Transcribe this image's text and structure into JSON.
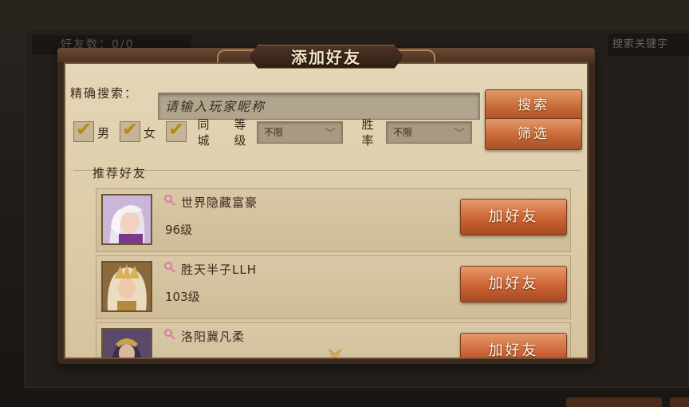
{
  "background": {
    "friend_count_text": "好友数：0/0",
    "search_hint_text": "搜索关键字"
  },
  "dialog": {
    "title": "添加好友",
    "search": {
      "label": "精确搜索：",
      "placeholder": "请输入玩家昵称",
      "button_label": "搜索"
    },
    "filters": {
      "male_label": "男",
      "male_checked": true,
      "female_label": "女",
      "female_checked": true,
      "same_city_label": [
        "同",
        "城"
      ],
      "same_city_checked": true,
      "level_label": [
        "等",
        "级"
      ],
      "level_value": "不限",
      "winrate_label": [
        "胜",
        "率"
      ],
      "winrate_value": "不限",
      "filter_button_label": "筛选"
    },
    "recommended": {
      "section_title": "推荐好友",
      "add_button_label": "加好友",
      "friends": [
        {
          "name": "世界隐藏富豪",
          "level": "96级",
          "gender": "female"
        },
        {
          "name": "胜天半子LLH",
          "level": "103级",
          "gender": "female"
        },
        {
          "name": "洛阳冀凡柔",
          "level": "",
          "gender": "female"
        }
      ]
    }
  },
  "colors": {
    "parchment": "#e4d6b8",
    "button_orange": "#cb6334",
    "text_dark": "#3b2a1c",
    "check_gold": "#b58a10",
    "gender_pink": "#d77aa5"
  }
}
